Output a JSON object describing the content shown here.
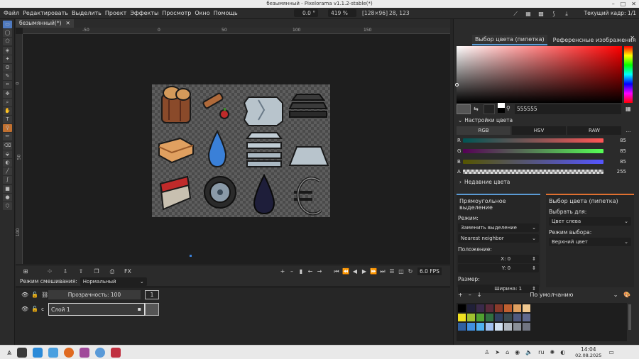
{
  "window": {
    "title": "безымянный - Pixelorama v1.1.2-stable(*)"
  },
  "menu": {
    "items": [
      "Файл",
      "Редактировать",
      "Выделить",
      "Проект",
      "Эффекты",
      "Просмотр",
      "Окно",
      "Помощь"
    ],
    "rotation": "0.0 °",
    "zoom": "419 %",
    "canvas_size": "[128×96]",
    "cursor_pos": "28, 123",
    "current_frame": "Текущий кадр: 1/1"
  },
  "tools": [
    "select-rect",
    "select-ellipse",
    "select-poly",
    "select-color",
    "select-magic",
    "select-lasso",
    "select-paint",
    "crop",
    "move",
    "zoom",
    "pan",
    "text",
    "color-picker",
    "pencil",
    "eraser",
    "bucket",
    "shading",
    "line",
    "curve",
    "rectangle",
    "ellipse",
    "3d-shape"
  ],
  "document": {
    "tab_label": "безымянный(*)",
    "close_glyph": "✕"
  },
  "ruler": {
    "h": [
      "-50",
      "0",
      "50",
      "100",
      "150"
    ],
    "v": [
      "0",
      "50",
      "100"
    ]
  },
  "animation": {
    "fps": "6.0 FPS"
  },
  "blend": {
    "label": "Режим смешивания:",
    "value": "Нормальный"
  },
  "layers": {
    "opacity_label": "Прозрачность: 100",
    "frame_number": "1",
    "layer_name": "Слой 1",
    "layer_prefix": "с"
  },
  "color_picker": {
    "tabs": [
      "Выбор цвета (пипетка)",
      "Референсные изображения"
    ],
    "hex": "555555",
    "settings_label": "Настройки цвета",
    "modes": [
      "RGB",
      "HSV",
      "RAW"
    ],
    "more": "...",
    "channels": [
      {
        "name": "R",
        "value": "85"
      },
      {
        "name": "G",
        "value": "85"
      },
      {
        "name": "B",
        "value": "85"
      },
      {
        "name": "A",
        "value": "255"
      }
    ],
    "recent_label": "Недавние цвета"
  },
  "tool_options_left": {
    "title": "Прямоугольное выделение",
    "mode_label": "Режим:",
    "mode_value": "Заменить выделение",
    "interp_value": "Nearest neighbor",
    "position_label": "Положение:",
    "x": "X: 0",
    "y": "Y: 0",
    "size_label": "Размер:",
    "width": "Ширина: 1"
  },
  "tool_options_right": {
    "title": "Выбор цвета (пипетка)",
    "pick_for_label": "Выбрать для:",
    "pick_for_value": "Цвет слева",
    "pick_mode_label": "Режим выбора:",
    "pick_mode_value": "Верхний цвет"
  },
  "palette": {
    "name": "По умолчанию",
    "colors": [
      "#000000",
      "#202038",
      "#3a2a4a",
      "#5a2a3a",
      "#8a3a2a",
      "#c06030",
      "#e0a060",
      "#f0c890",
      "#f0e020",
      "#a0c030",
      "#50a030",
      "#307040",
      "#304060",
      "#3a4a50",
      "#505a80",
      "#606a90",
      "#3060a0",
      "#4090e0",
      "#50b0f0",
      "#a0c0f0",
      "#d0e0f0",
      "#b0b8c0",
      "#8a9098",
      "#707480"
    ]
  },
  "taskbar": {
    "lang": "ru",
    "time": "14:04",
    "date": "02.08.2025"
  }
}
